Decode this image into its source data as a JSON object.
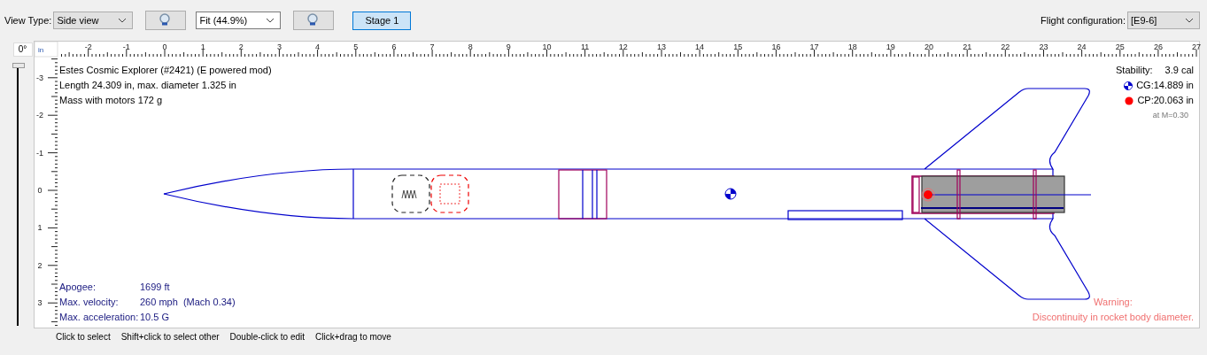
{
  "toolbar": {
    "view_type_label": "View Type:",
    "view_type": "Side view",
    "zoom": "Fit (44.9%)",
    "stages": [
      {
        "label": "Stage 1",
        "selected": true
      }
    ],
    "flight_config_label": "Flight configuration:",
    "flight_config": "[E9-6]"
  },
  "rotation": {
    "value": "0°",
    "level": 0
  },
  "ruler": {
    "unit": "in",
    "x_labels": [
      "-2",
      "-1",
      "0",
      "1",
      "2",
      "3",
      "4",
      "5",
      "6",
      "7",
      "8",
      "9",
      "10",
      "11",
      "12",
      "13",
      "14",
      "15",
      "16",
      "17",
      "18",
      "19",
      "20",
      "21",
      "22",
      "23",
      "24",
      "25",
      "26",
      "27"
    ],
    "y_labels": [
      "-3",
      "-2",
      "-1",
      "0",
      "1",
      "2",
      "3"
    ]
  },
  "info": [
    "Estes Cosmic Explorer (#2421) (E powered mod)",
    "Length 24.309 in, max. diameter 1.325 in",
    "Mass with motors 172 g"
  ],
  "stability": {
    "label": "Stability:",
    "value": "3.9 cal",
    "cg": "CG:14.889 in",
    "cp": "CP:20.063 in",
    "mach": "at M=0.30"
  },
  "flight_stats": [
    {
      "label": "Apogee:",
      "value": "1699 ft"
    },
    {
      "label": "Max. velocity:",
      "value": "260 mph  (Mach 0.34)"
    },
    {
      "label": "Max. acceleration:",
      "value": "10.5 G"
    }
  ],
  "warnings": [
    "Warning:",
    "Discontinuity in rocket body diameter."
  ],
  "hints": [
    "Click to select",
    "Shift+click to select other",
    "Double-click to edit",
    "Click+drag to move"
  ]
}
